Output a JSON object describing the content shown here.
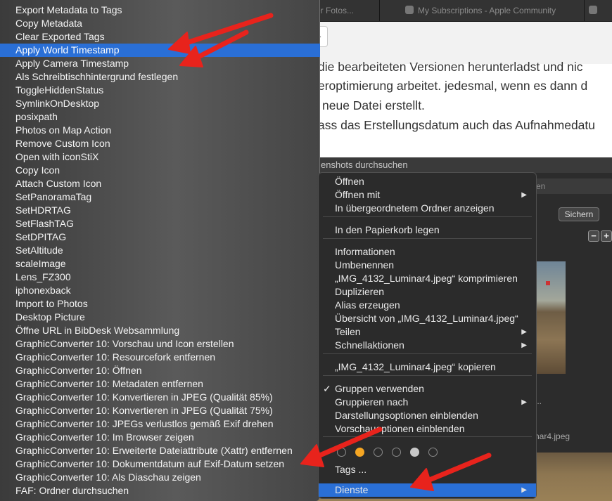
{
  "browser": {
    "tabs": [
      {
        "label": "er Fotos..."
      },
      {
        "label": "My Subscriptions - Apple Community"
      }
    ]
  },
  "toolbar": {
    "field_text": ""
  },
  "article": {
    "lines": [
      "die bearbeiteten Versionen herunterladst und nic",
      "eroptimierung arbeitet. jedesmal, wenn es dann d",
      "neue Datei erstellt.",
      "ass das Erstellungsdatum auch das Aufnahmedatu"
    ]
  },
  "finder": {
    "title": "enshots durchsuchen",
    "search_placeholder": "en",
    "save_button": "Sichern",
    "minus": "−",
    "plus": "+",
    "ellipsis": "...",
    "filename": "nar4.jpeg"
  },
  "services_menu": {
    "items": [
      {
        "label": "Export Metadata to Tags"
      },
      {
        "label": "Copy Metadata"
      },
      {
        "label": "Clear Exported Tags"
      },
      {
        "label": "Apply World Timestamp",
        "highlighted": true
      },
      {
        "label": "Apply Camera Timestamp"
      },
      {
        "label": "Als Schreibtischhintergrund festlegen"
      },
      {
        "label": "ToggleHiddenStatus"
      },
      {
        "label": "SymlinkOnDesktop"
      },
      {
        "label": "posixpath"
      },
      {
        "label": "Photos on Map Action"
      },
      {
        "label": "Remove Custom Icon"
      },
      {
        "label": "Open with iconStiX"
      },
      {
        "label": "Copy Icon"
      },
      {
        "label": "Attach Custom Icon"
      },
      {
        "label": "SetPanoramaTag"
      },
      {
        "label": "SetHDRTAG"
      },
      {
        "label": "SetFlashTAG"
      },
      {
        "label": "SetDPITAG"
      },
      {
        "label": "SetAltitude"
      },
      {
        "label": "scaleImage"
      },
      {
        "label": "Lens_FZ300"
      },
      {
        "label": "iphonexback"
      },
      {
        "label": "Import to Photos"
      },
      {
        "label": "Desktop Picture"
      },
      {
        "label": "Öffne URL in BibDesk Websammlung"
      },
      {
        "label": "GraphicConverter 10: Vorschau und Icon erstellen"
      },
      {
        "label": "GraphicConverter 10: Resourcefork entfernen"
      },
      {
        "label": "GraphicConverter 10: Öffnen"
      },
      {
        "label": "GraphicConverter 10: Metadaten entfernen"
      },
      {
        "label": "GraphicConverter 10: Konvertieren in JPEG (Qualität 85%)"
      },
      {
        "label": "GraphicConverter 10: Konvertieren in JPEG (Qualität 75%)"
      },
      {
        "label": "GraphicConverter 10: JPEGs verlustlos gemäß Exif drehen"
      },
      {
        "label": "GraphicConverter 10: Im Browser zeigen"
      },
      {
        "label": "GraphicConverter 10: Erweiterte Dateiattribute (Xattr) entfernen"
      },
      {
        "label": "GraphicConverter 10: Dokumentdatum auf Exif-Datum setzen"
      },
      {
        "label": "GraphicConverter 10: Als Diaschau zeigen"
      },
      {
        "label": "FAF: Ordner durchsuchen"
      }
    ]
  },
  "context_menu": {
    "items": [
      {
        "label": "Öffnen"
      },
      {
        "label": "Öffnen mit",
        "submenu": true
      },
      {
        "label": "In übergeordnetem Ordner anzeigen"
      },
      {
        "label": "In den Papierkorb legen"
      },
      {
        "label": "Informationen"
      },
      {
        "label": "Umbenennen"
      },
      {
        "label": "„IMG_4132_Luminar4.jpeg“ komprimieren"
      },
      {
        "label": "Duplizieren"
      },
      {
        "label": "Alias erzeugen"
      },
      {
        "label": "Übersicht von „IMG_4132_Luminar4.jpeg“"
      },
      {
        "label": "Teilen",
        "submenu": true
      },
      {
        "label": "Schnellaktionen",
        "submenu": true
      },
      {
        "label": "„IMG_4132_Luminar4.jpeg“ kopieren"
      },
      {
        "label": "Gruppen verwenden",
        "checked": true
      },
      {
        "label": "Gruppieren nach",
        "submenu": true
      },
      {
        "label": "Darstellungsoptionen einblenden"
      },
      {
        "label": "Vorschauoptionen einblenden"
      },
      {
        "label": "Tags ..."
      },
      {
        "label": "Dienste",
        "submenu": true,
        "highlighted": true
      }
    ],
    "submenu_glyph": "▶",
    "check_glyph": "✓",
    "tag_colors": [
      "none",
      "#f5a623",
      "none",
      "none",
      "#c8c8c8",
      "none"
    ]
  },
  "colors": {
    "highlight": "#2a6fd6",
    "annotation_arrow": "#e8231c"
  }
}
